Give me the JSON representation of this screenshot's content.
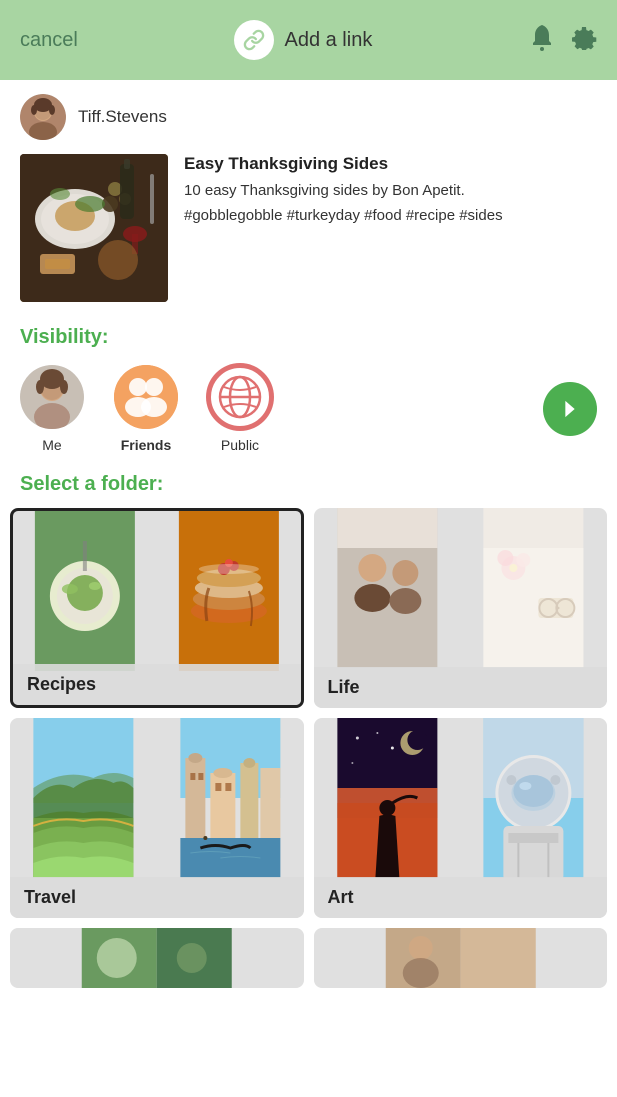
{
  "header": {
    "cancel_label": "cancel",
    "title": "Add a link",
    "accent_color": "#a8d5a2"
  },
  "user": {
    "username": "Tiff.Stevens"
  },
  "post": {
    "title": "Easy Thanksgiving Sides",
    "description": "10 easy Thanksgiving sides by Bon Apetit.",
    "hashtags": "#gobblegobble #turkeyday #food #recipe #sides"
  },
  "visibility": {
    "label": "Visibility:",
    "options": [
      {
        "id": "me",
        "label": "Me",
        "selected": false
      },
      {
        "id": "friends",
        "label": "Friends",
        "selected": false,
        "bold": true
      },
      {
        "id": "public",
        "label": "Public",
        "selected": true
      }
    ]
  },
  "folder_section": {
    "label": "Select a folder:",
    "folders": [
      {
        "id": "recipes",
        "label": "Recipes",
        "selected": true
      },
      {
        "id": "life",
        "label": "Life",
        "selected": false
      },
      {
        "id": "travel",
        "label": "Travel",
        "selected": false
      },
      {
        "id": "art",
        "label": "Art",
        "selected": false
      }
    ]
  }
}
